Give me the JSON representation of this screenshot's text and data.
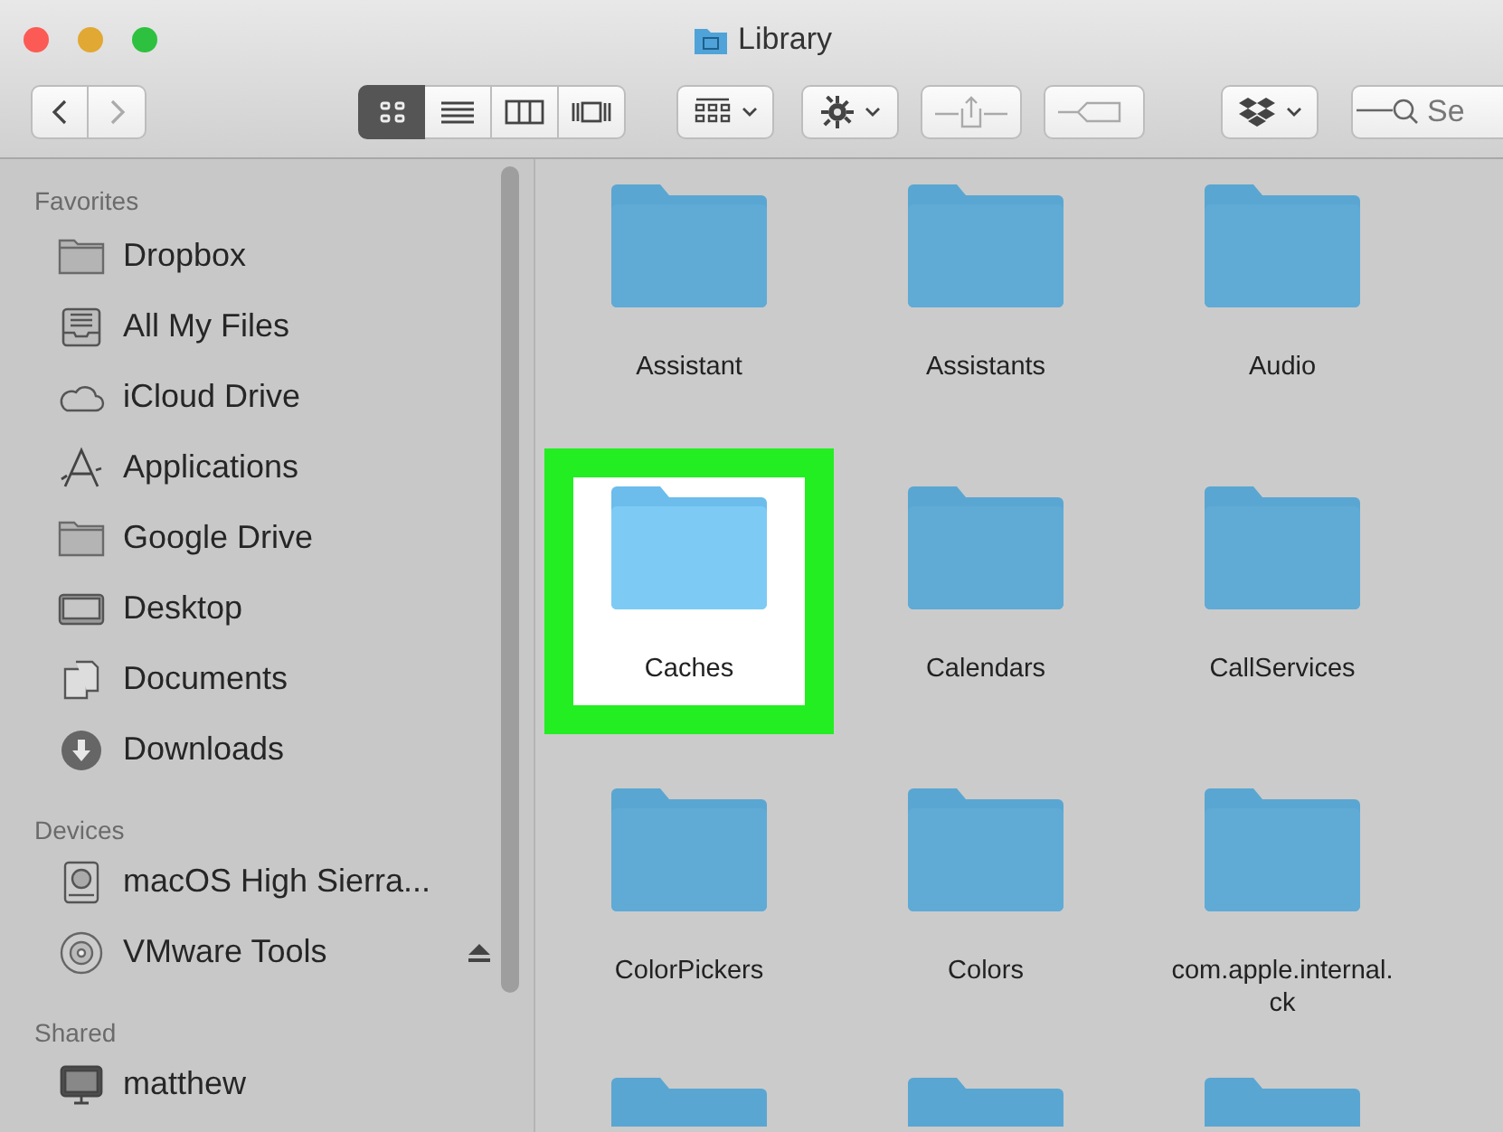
{
  "window": {
    "title": "Library"
  },
  "toolbar": {
    "nav": [
      {
        "kind": "back",
        "disabled": false
      },
      {
        "kind": "forward",
        "disabled": true
      }
    ],
    "views": [
      {
        "kind": "icons",
        "selected": true
      },
      {
        "kind": "list",
        "selected": false
      },
      {
        "kind": "columns",
        "selected": false
      },
      {
        "kind": "gallery",
        "selected": false
      }
    ],
    "tools": [
      {
        "kind": "arrange",
        "menu": true,
        "disabled": false
      },
      {
        "kind": "action",
        "menu": true,
        "disabled": false
      },
      {
        "kind": "share",
        "menu": false,
        "disabled": true
      },
      {
        "kind": "tags",
        "menu": false,
        "disabled": true
      },
      {
        "kind": "dropbox",
        "menu": true,
        "disabled": false
      }
    ],
    "search": {
      "placeholder": "Se"
    }
  },
  "sidebar": {
    "sections": [
      {
        "title": "Favorites",
        "items": [
          {
            "label": "Dropbox",
            "kind": "folder",
            "eject": false
          },
          {
            "label": "All My Files",
            "kind": "files",
            "eject": false
          },
          {
            "label": "iCloud Drive",
            "kind": "cloud",
            "eject": false
          },
          {
            "label": "Applications",
            "kind": "apps",
            "eject": false
          },
          {
            "label": "Google Drive",
            "kind": "folder",
            "eject": false
          },
          {
            "label": "Desktop",
            "kind": "desktop",
            "eject": false
          },
          {
            "label": "Documents",
            "kind": "documents",
            "eject": false
          },
          {
            "label": "Downloads",
            "kind": "downloads",
            "eject": false
          }
        ]
      },
      {
        "title": "Devices",
        "items": [
          {
            "label": "macOS High Sierra...",
            "kind": "disk",
            "eject": false
          },
          {
            "label": "VMware Tools",
            "kind": "disc",
            "eject": true
          }
        ]
      },
      {
        "title": "Shared",
        "items": [
          {
            "label": "matthew",
            "kind": "computer",
            "eject": false
          }
        ]
      }
    ]
  },
  "files": [
    {
      "name": "Assistant",
      "selected": false
    },
    {
      "name": "Assistants",
      "selected": false
    },
    {
      "name": "Audio",
      "selected": false
    },
    {
      "name": "Caches",
      "selected": true
    },
    {
      "name": "Calendars",
      "selected": false
    },
    {
      "name": "CallServices",
      "selected": false
    },
    {
      "name": "ColorPickers",
      "selected": false
    },
    {
      "name": "Colors",
      "selected": false
    },
    {
      "name": "com.apple.internal.ck",
      "selected": false
    }
  ]
}
